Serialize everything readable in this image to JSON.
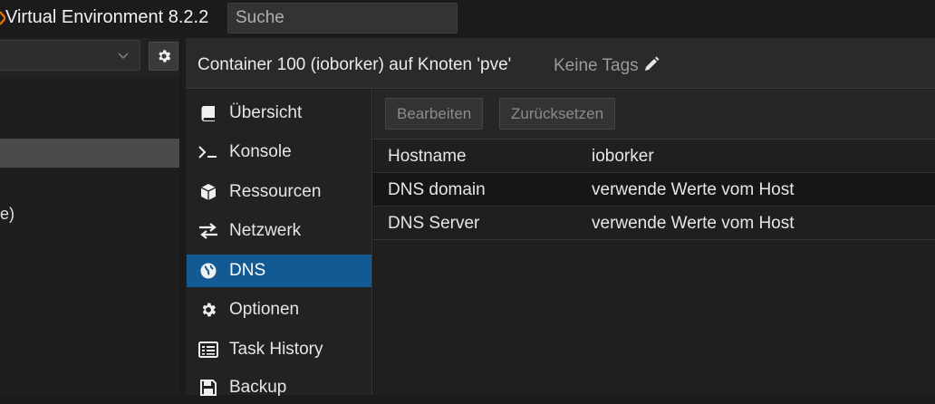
{
  "app": {
    "title": "Virtual Environment 8.2.2",
    "search_placeholder": "Suche",
    "brand_color": "#e57000"
  },
  "tree": {
    "view_value": "",
    "rows": [
      {
        "label": ""
      },
      {
        "label": ""
      },
      {
        "label": "e)"
      }
    ]
  },
  "header": {
    "title": "Container 100 (ioborker) auf Knoten 'pve'",
    "tags": "Keine Tags"
  },
  "nav": {
    "items": [
      {
        "label": "Übersicht",
        "icon": "book-icon"
      },
      {
        "label": "Konsole",
        "icon": "terminal-icon"
      },
      {
        "label": "Ressourcen",
        "icon": "cube-icon"
      },
      {
        "label": "Netzwerk",
        "icon": "exchange-icon"
      },
      {
        "label": "DNS",
        "icon": "globe-icon",
        "active": true
      },
      {
        "label": "Optionen",
        "icon": "gear-icon"
      },
      {
        "label": "Task History",
        "icon": "list-icon"
      },
      {
        "label": "Backup",
        "icon": "floppy-icon"
      }
    ],
    "active_color": "#135a94"
  },
  "toolbar": {
    "edit_label": "Bearbeiten",
    "reset_label": "Zurücksetzen"
  },
  "grid": {
    "rows": [
      {
        "key": "Hostname",
        "value": "ioborker"
      },
      {
        "key": "DNS domain",
        "value": "verwende Werte vom Host"
      },
      {
        "key": "DNS Server",
        "value": "verwende Werte vom Host"
      }
    ]
  }
}
